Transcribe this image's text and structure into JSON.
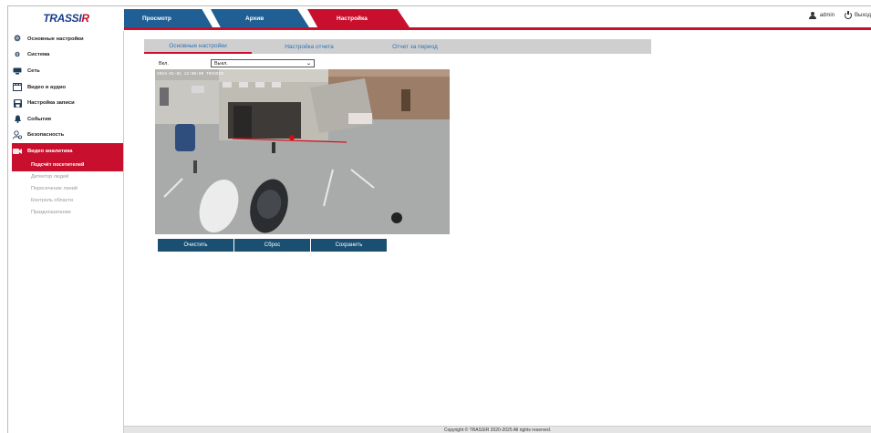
{
  "brand": {
    "logo_main": "TRASSI",
    "logo_accent": "R"
  },
  "top_tabs": [
    {
      "label": "Просмотр"
    },
    {
      "label": "Архив"
    },
    {
      "label": "Настройка"
    }
  ],
  "user": {
    "name": "admin",
    "logout": "Выход"
  },
  "sidebar": {
    "items": [
      {
        "label": "Основные настройки",
        "icon": "gear-icon"
      },
      {
        "label": "Система",
        "icon": "gears-icon"
      },
      {
        "label": "Сеть",
        "icon": "network-icon"
      },
      {
        "label": "Видео и аудио",
        "icon": "video-icon"
      },
      {
        "label": "Настройка записи",
        "icon": "save-icon"
      },
      {
        "label": "События",
        "icon": "bell-icon"
      },
      {
        "label": "Безопасность",
        "icon": "user-shield-icon"
      },
      {
        "label": "Видео аналитика",
        "icon": "analytics-icon"
      }
    ],
    "subitems": [
      {
        "label": "Подсчёт посетителей"
      },
      {
        "label": "Детектор людей"
      },
      {
        "label": "Пересечение линий"
      },
      {
        "label": "Контроль области"
      },
      {
        "label": "Праздношатание"
      }
    ]
  },
  "subtabs": [
    {
      "label": "Основные настройки"
    },
    {
      "label": "Настройка отчета"
    },
    {
      "label": "Отчет за период"
    }
  ],
  "form": {
    "enable_label": "Вкл.",
    "enable_value": "Выкл."
  },
  "camera": {
    "timestamp": "2024-01-01 12:00:00 TRASSIR"
  },
  "buttons": {
    "clear": "Очистить",
    "reset": "Сброс",
    "save": "Сохранить"
  },
  "footer": {
    "copyright": "Copyright © TRASSIR 2020-2025 All rights reserved."
  },
  "colors": {
    "accent": "#c8102e",
    "brand_blue": "#1f5f93",
    "button": "#1a4f72",
    "link": "#2d73b5"
  }
}
